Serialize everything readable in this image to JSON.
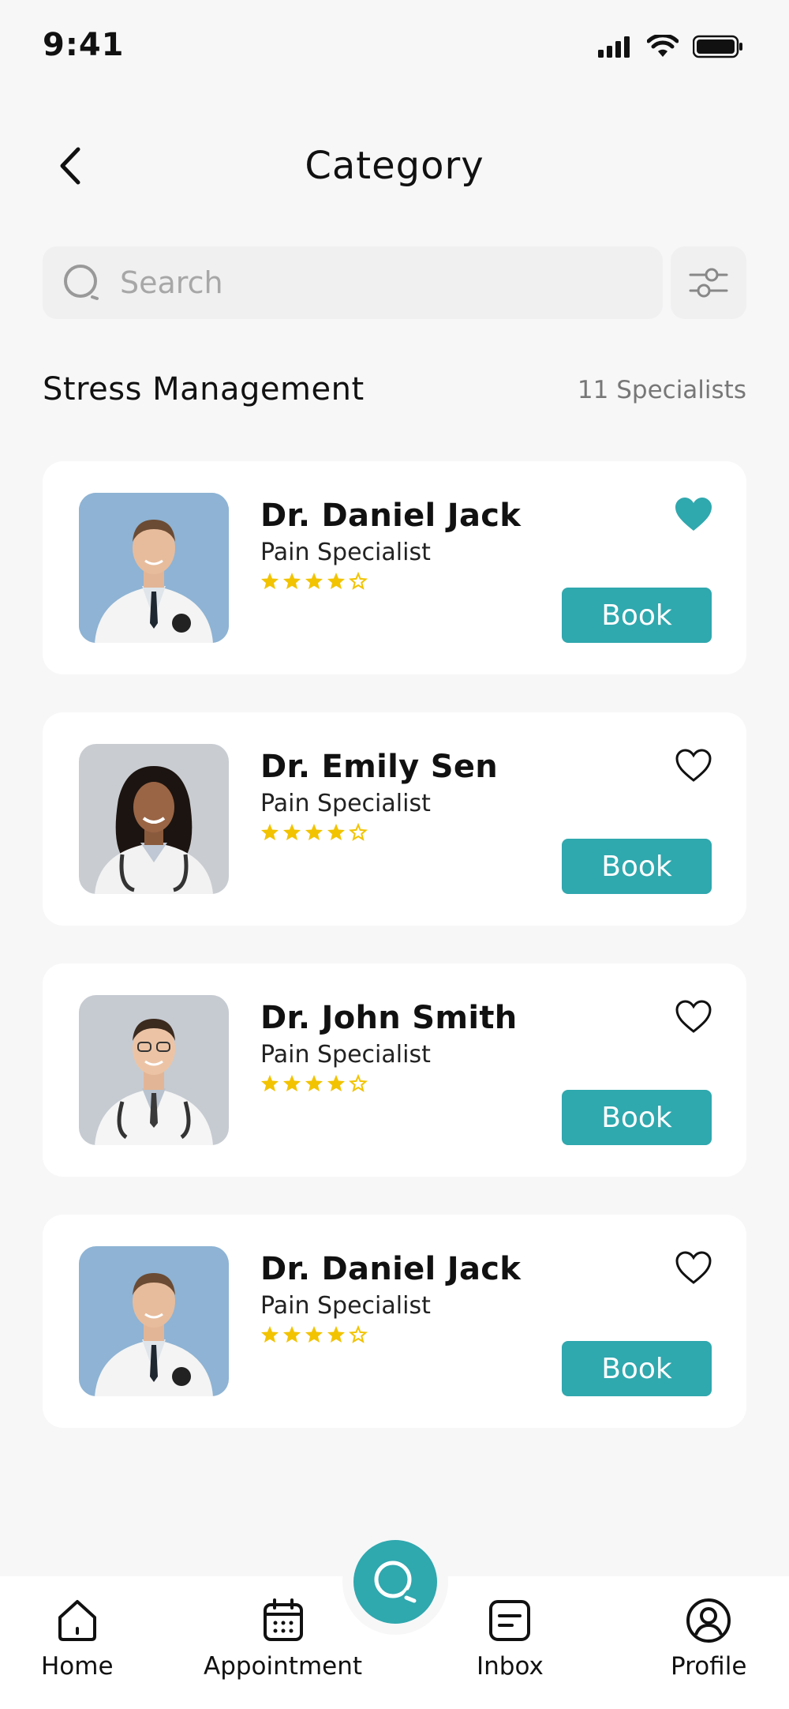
{
  "status_bar": {
    "time": "9:41"
  },
  "header": {
    "title": "Category",
    "back_icon": "chevron-left-icon"
  },
  "search": {
    "placeholder": "Search",
    "value": "",
    "filter_icon": "sliders-icon"
  },
  "section": {
    "title": "Stress Management",
    "count": "11 Specialists"
  },
  "colors": {
    "accent": "#2fa8ae",
    "star": "#f2c300",
    "background": "#f7f7f8",
    "card": "#ffffff"
  },
  "doctors": [
    {
      "name": "Dr. Daniel Jack",
      "specialty": "Pain Specialist",
      "rating": 4,
      "rating_max": 5,
      "favorite": true,
      "book_label": "Book"
    },
    {
      "name": "Dr. Emily Sen",
      "specialty": "Pain Specialist",
      "rating": 4,
      "rating_max": 5,
      "favorite": false,
      "book_label": "Book"
    },
    {
      "name": "Dr. John Smith",
      "specialty": "Pain Specialist",
      "rating": 4,
      "rating_max": 5,
      "favorite": false,
      "book_label": "Book"
    },
    {
      "name": "Dr. Daniel Jack",
      "specialty": "Pain Specialist",
      "rating": 4,
      "rating_max": 5,
      "favorite": false,
      "book_label": "Book"
    }
  ],
  "bottom_nav": {
    "items": [
      {
        "label": "Home",
        "icon": "home-icon"
      },
      {
        "label": "Appointment",
        "icon": "calendar-icon"
      },
      {
        "label": "Inbox",
        "icon": "inbox-icon"
      },
      {
        "label": "Profile",
        "icon": "profile-icon"
      }
    ],
    "fab_icon": "search-icon"
  }
}
